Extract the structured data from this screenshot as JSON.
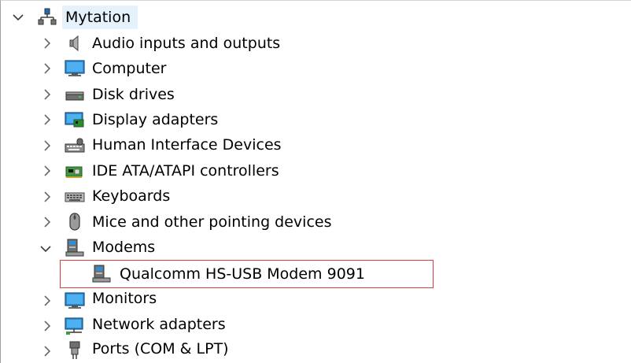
{
  "tree": {
    "root": {
      "label": "Mytation",
      "expanded": true,
      "icon": "computer-network-icon"
    },
    "categories": [
      {
        "label": "Audio inputs and outputs",
        "icon": "speaker-icon",
        "expanded": false
      },
      {
        "label": "Computer",
        "icon": "monitor-icon",
        "expanded": false
      },
      {
        "label": "Disk drives",
        "icon": "disk-drive-icon",
        "expanded": false
      },
      {
        "label": "Display adapters",
        "icon": "display-adapter-icon",
        "expanded": false
      },
      {
        "label": "Human Interface Devices",
        "icon": "hid-icon",
        "expanded": false
      },
      {
        "label": "IDE ATA/ATAPI controllers",
        "icon": "ide-controller-icon",
        "expanded": false
      },
      {
        "label": "Keyboards",
        "icon": "keyboard-icon",
        "expanded": false
      },
      {
        "label": "Mice and other pointing devices",
        "icon": "mouse-icon",
        "expanded": false
      },
      {
        "label": "Modems",
        "icon": "modem-icon",
        "expanded": true,
        "children": [
          {
            "label": "Qualcomm HS-USB Modem 9091",
            "icon": "modem-icon"
          }
        ]
      },
      {
        "label": "Monitors",
        "icon": "monitor-icon",
        "expanded": false
      },
      {
        "label": "Network adapters",
        "icon": "network-adapter-icon",
        "expanded": false
      },
      {
        "label": "Ports (COM & LPT)",
        "icon": "port-icon",
        "expanded": false
      }
    ]
  },
  "colors": {
    "root_highlight": "#e5f1fb",
    "annotation_box": "#e0393a",
    "chevron": "#5a5a5a"
  }
}
